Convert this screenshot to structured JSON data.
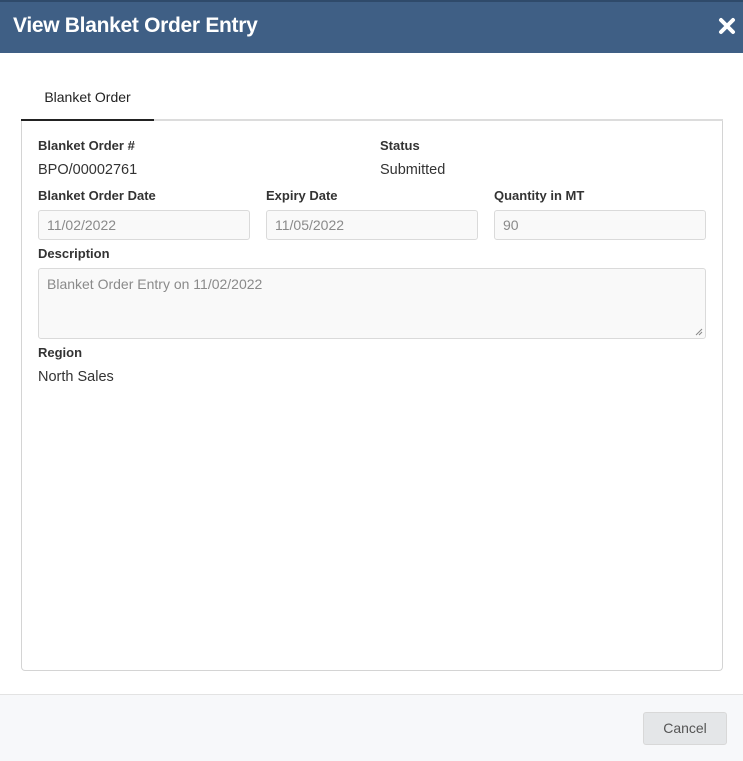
{
  "dialog": {
    "title": "View Blanket Order Entry",
    "close_icon": "close-icon"
  },
  "tabs": [
    {
      "label": "Blanket Order",
      "active": true
    }
  ],
  "form": {
    "blanket_order_no": {
      "label": "Blanket Order #",
      "value": "BPO/00002761"
    },
    "status": {
      "label": "Status",
      "value": "Submitted"
    },
    "blanket_order_date": {
      "label": "Blanket Order Date",
      "value": "11/02/2022"
    },
    "expiry_date": {
      "label": "Expiry Date",
      "value": "11/05/2022"
    },
    "quantity": {
      "label": "Quantity in MT",
      "value": "90"
    },
    "description": {
      "label": "Description",
      "value": "Blanket Order Entry on 11/02/2022"
    },
    "region": {
      "label": "Region",
      "value": "North Sales"
    }
  },
  "footer": {
    "cancel_label": "Cancel"
  },
  "colors": {
    "header_bg": "#3f5f85",
    "footer_bg": "#f7f8fa"
  }
}
